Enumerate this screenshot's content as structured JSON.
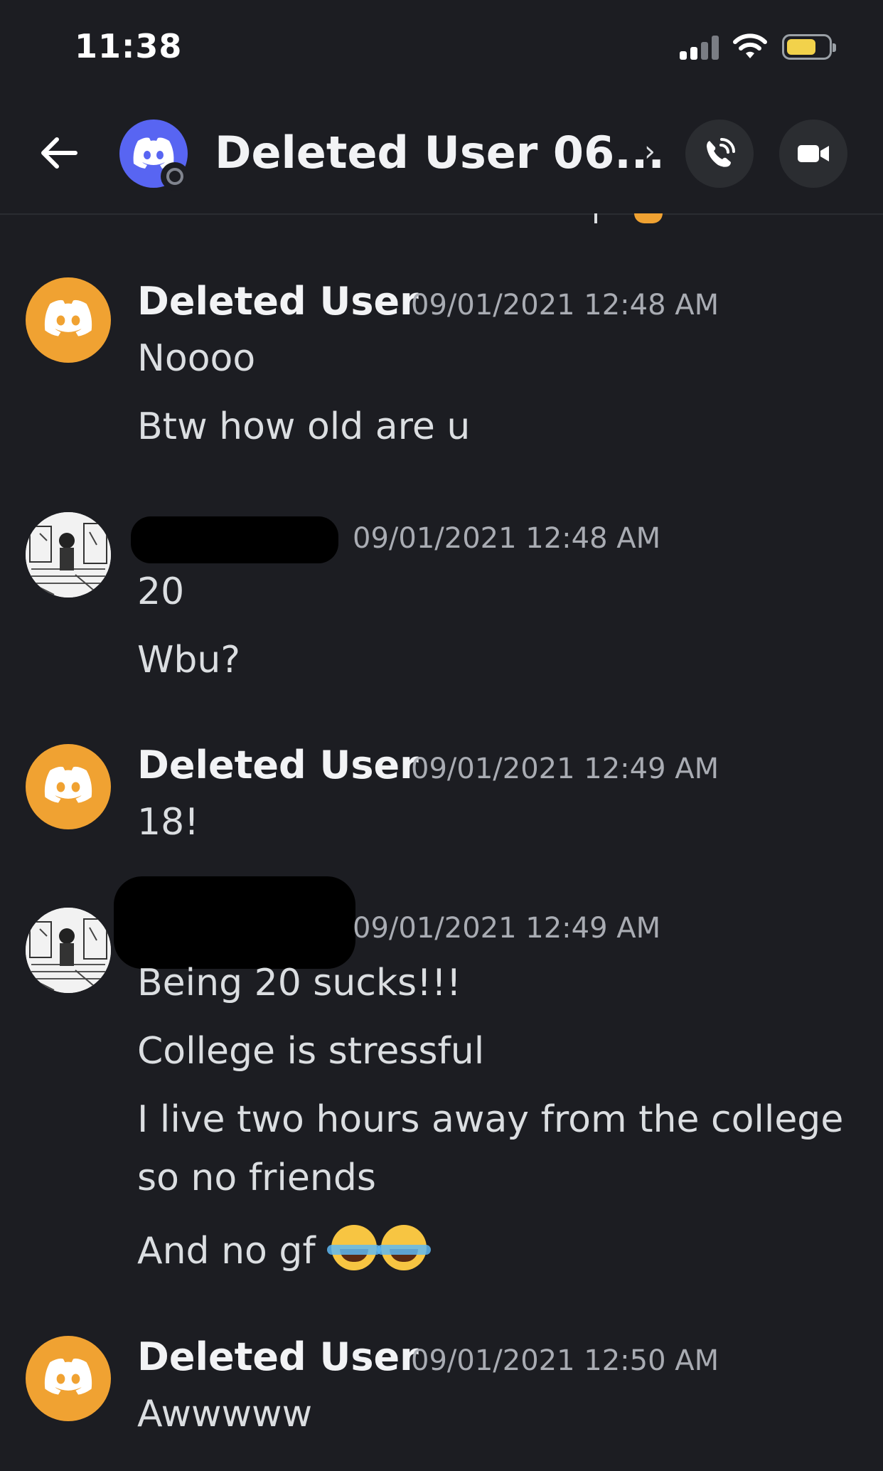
{
  "status_bar": {
    "time": "11:38",
    "battery_color": "#f2d24b"
  },
  "header": {
    "title": "Deleted User 06...",
    "chevron": "›",
    "avatar_color": "#5865f2",
    "icons": [
      "back-arrow-icon",
      "discord-logo-icon",
      "phone-call-icon",
      "video-camera-icon"
    ]
  },
  "messages": [
    {
      "author": "Deleted User",
      "timestamp": "09/01/2021 12:48 AM",
      "avatar": "discord-default-orange",
      "lines": [
        "Noooo",
        "Btw how old are u"
      ]
    },
    {
      "author": "",
      "author_redacted": true,
      "timestamp": "09/01/2021 12:48 AM",
      "avatar": "manga-photo",
      "lines": [
        "20",
        "Wbu?"
      ]
    },
    {
      "author": "Deleted User",
      "timestamp": "09/01/2021 12:49 AM",
      "avatar": "discord-default-orange",
      "lines": [
        "18!"
      ]
    },
    {
      "author": "",
      "author_redacted": true,
      "timestamp": "09/01/2021 12:49 AM",
      "avatar": "manga-photo",
      "lines": [
        "Being 20 sucks!!!",
        "College is stressful",
        "I live two hours away from the college",
        "so no friends",
        "And no gf"
      ],
      "emoji": [
        "face-with-tears-of-joy",
        "face-with-tears-of-joy"
      ]
    },
    {
      "author": "Deleted User",
      "timestamp": "09/01/2021 12:50 AM",
      "avatar": "discord-default-orange",
      "lines": [
        "Awwwww"
      ]
    }
  ],
  "colors": {
    "background": "#1c1d22",
    "discord_orange": "#f0a232",
    "timestamp": "#a9acb3"
  }
}
